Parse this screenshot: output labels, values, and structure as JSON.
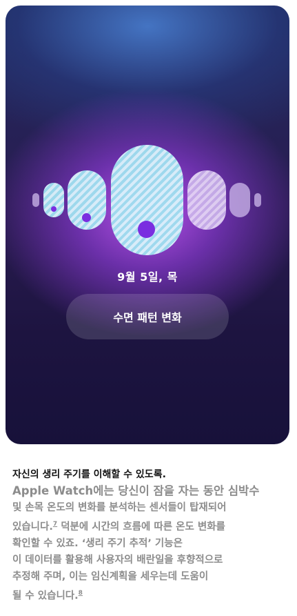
{
  "card": {
    "date_label": "9월 5일, 목",
    "button_label": "수면 패턴 변화"
  },
  "text": {
    "heading": "자신의 생리 주기를 이해할 수 있도록.",
    "line1": "Apple Watch에는 당신이 잠을 자는 동안 심박수",
    "line2": "및 손목 온도의 변화를 분석하는 센서들이 탑재되어",
    "line3": "있습니다.",
    "line3_ref": "7",
    "line3_rest": " 덕분에 시간의 흐름에 따른 온도 변화를",
    "line4": "확인할 수 있죠. ‘생리 주기 추적’ 기능은",
    "line5": "이 데이터를 활용해 사용자의 배란일을 후향적으로",
    "line6": "추정해 주며, 이는 임신계획을 세우는데 도움이",
    "line7": "될 수 있습니다.",
    "line7_ref": "8"
  },
  "colors": {
    "accent_dot": "#7a2ee0",
    "stripe_blue": "#a0e1f0",
    "stripe_lavender": "#d2bef0"
  }
}
